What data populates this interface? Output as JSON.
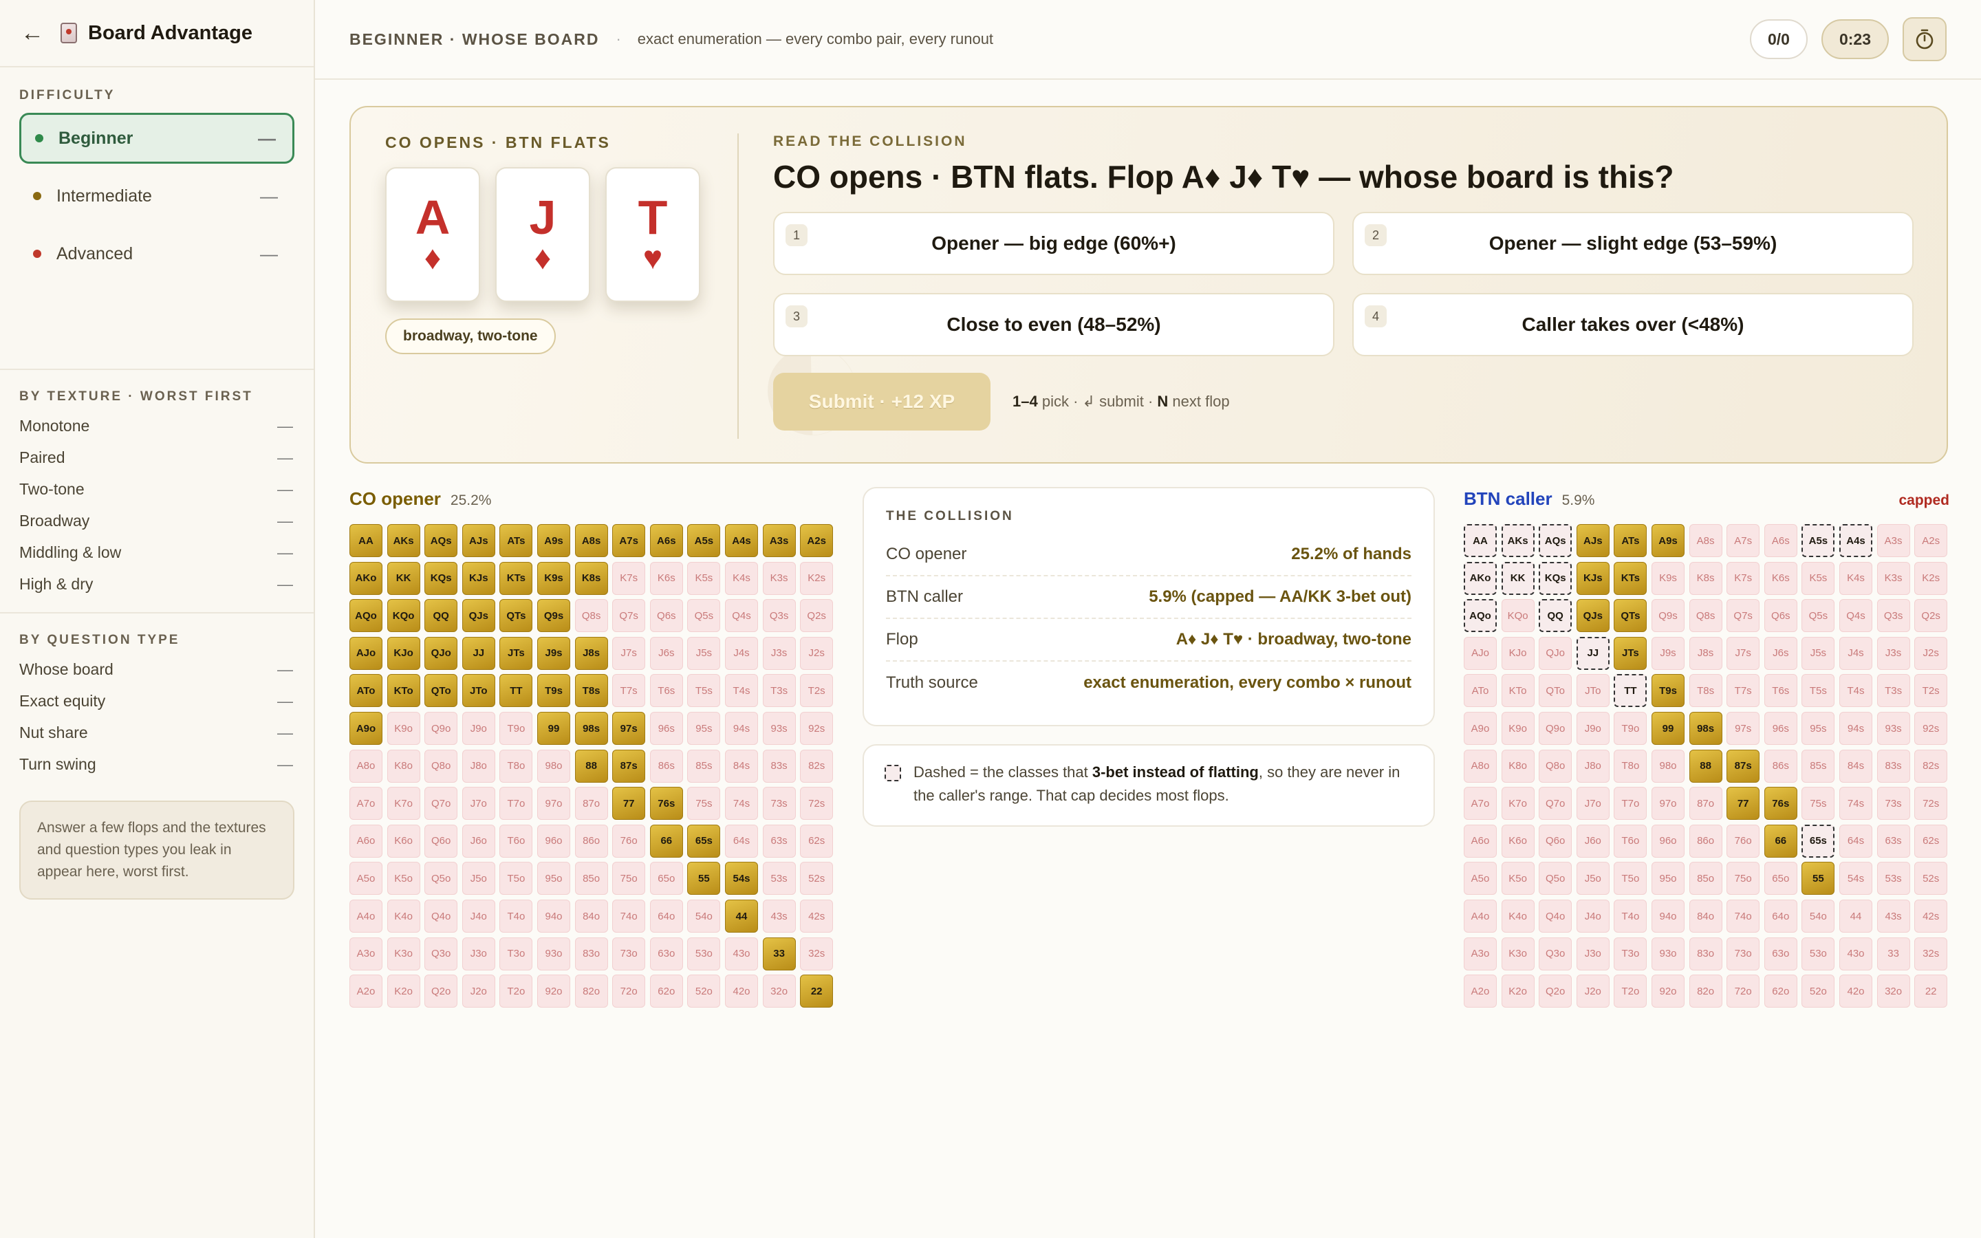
{
  "sidebar": {
    "title": "Board Advantage",
    "difficulty_title": "DIFFICULTY",
    "difficulty": [
      {
        "label": "Beginner",
        "value": "—",
        "color": "#2f8a4a"
      },
      {
        "label": "Intermediate",
        "value": "—",
        "color": "#8a6a12"
      },
      {
        "label": "Advanced",
        "value": "—",
        "color": "#c0392b"
      }
    ],
    "texture_title": "BY TEXTURE · WORST FIRST",
    "textures": [
      {
        "label": "Monotone",
        "value": "—"
      },
      {
        "label": "Paired",
        "value": "—"
      },
      {
        "label": "Two-tone",
        "value": "—"
      },
      {
        "label": "Broadway",
        "value": "—"
      },
      {
        "label": "Middling & low",
        "value": "—"
      },
      {
        "label": "High & dry",
        "value": "—"
      }
    ],
    "qtype_title": "BY QUESTION TYPE",
    "qtypes": [
      {
        "label": "Whose board",
        "value": "—"
      },
      {
        "label": "Exact equity",
        "value": "—"
      },
      {
        "label": "Nut share",
        "value": "—"
      },
      {
        "label": "Turn swing",
        "value": "—"
      }
    ],
    "hint": "Answer a few flops and the textures and question types you leak in appear here, worst first."
  },
  "header": {
    "title": "BEGINNER · WHOSE BOARD",
    "separator": "·",
    "subtitle": "exact enumeration — every combo pair, every runout",
    "score": "0/0",
    "timer": "0:23",
    "timer_icon": "stopwatch-icon"
  },
  "question": {
    "spot": "CO OPENS · BTN FLATS",
    "cards": [
      {
        "rank": "A",
        "suit": "♦"
      },
      {
        "rank": "J",
        "suit": "♦"
      },
      {
        "rank": "T",
        "suit": "♥"
      }
    ],
    "texture": "broadway, two-tone",
    "label": "READ THE COLLISION",
    "text": "CO opens · BTN flats. Flop A♦ J♦ T♥ — whose board is this?",
    "options": [
      {
        "num": "1",
        "label": "Opener — big edge (60%+)"
      },
      {
        "num": "2",
        "label": "Opener — slight edge (53–59%)"
      },
      {
        "num": "3",
        "label": "Close to even (48–52%)"
      },
      {
        "num": "4",
        "label": "Caller takes over (<48%)"
      }
    ],
    "submit": "Submit · +12 XP",
    "hint_keys": "1–4",
    "hint_pick": " pick · ",
    "hint_enter": "↲",
    "hint_submit": " submit · ",
    "hint_n": "N",
    "hint_next": " next flop"
  },
  "opener": {
    "name": "CO opener",
    "pct": "25.2%"
  },
  "caller": {
    "name": "BTN caller",
    "pct": "5.9%",
    "capped": "capped"
  },
  "collision": {
    "title": "THE COLLISION",
    "rows": [
      {
        "k": "CO opener",
        "v": "25.2% of hands"
      },
      {
        "k": "BTN caller",
        "v": "5.9% (capped — AA/KK 3-bet out)"
      },
      {
        "k": "Flop",
        "v": "A♦ J♦ T♥ · broadway, two-tone"
      },
      {
        "k": "Truth source",
        "v": "exact enumeration, every combo × runout"
      }
    ]
  },
  "note": {
    "a": "Dashed = the classes that ",
    "b": "3-bet instead of flatting",
    "c": ", so they are never in the caller's range. That cap decides most flops."
  },
  "colors": {
    "in_range": "#d4aa2c",
    "out_range": "#f9e5e5",
    "opener_name": "#7a5d00",
    "caller_name": "#2244bb",
    "capped": "#b02a20"
  },
  "ranks": [
    "A",
    "K",
    "Q",
    "J",
    "T",
    "9",
    "8",
    "7",
    "6",
    "5",
    "4",
    "3",
    "2"
  ],
  "opener_range": [
    "AA",
    "AKs",
    "AQs",
    "AJs",
    "ATs",
    "A9s",
    "A8s",
    "A7s",
    "A6s",
    "A5s",
    "A4s",
    "A3s",
    "A2s",
    "AKo",
    "KK",
    "KQs",
    "KJs",
    "KTs",
    "K9s",
    "K8s",
    "AQo",
    "KQo",
    "QQ",
    "QJs",
    "QTs",
    "Q9s",
    "AJo",
    "KJo",
    "QJo",
    "JJ",
    "JTs",
    "J9s",
    "J8s",
    "ATo",
    "KTo",
    "QTo",
    "JTo",
    "TT",
    "T9s",
    "T8s",
    "A9o",
    "99",
    "98s",
    "97s",
    "88",
    "87s",
    "77",
    "76s",
    "66",
    "65s",
    "55",
    "54s",
    "44",
    "33",
    "22"
  ],
  "caller_range": [
    "AJs",
    "ATs",
    "A9s",
    "KJs",
    "KTs",
    "QJs",
    "QTs",
    "JTs",
    "T9s",
    "99",
    "98s",
    "88",
    "87s",
    "77",
    "76s",
    "66",
    "55"
  ],
  "caller_dashed": [
    "AA",
    "AKs",
    "AQs",
    "A5s",
    "A4s",
    "AKo",
    "KK",
    "KQs",
    "AQo",
    "QQ",
    "JJ",
    "TT",
    "65s"
  ]
}
